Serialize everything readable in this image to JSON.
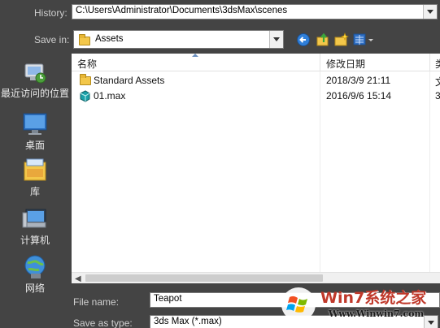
{
  "history": {
    "label": "History:",
    "value": "C:\\Users\\Administrator\\Documents\\3dsMax\\scenes"
  },
  "save_in": {
    "label": "Save in:",
    "value": "Assets"
  },
  "toolbar": {
    "back_icon": "back-arrow-icon",
    "up_icon": "up-folder-icon",
    "new_folder_icon": "new-folder-icon",
    "view_icon": "view-menu-icon"
  },
  "places": [
    {
      "label": "最近访问的位置",
      "icon": "recent-places-icon"
    },
    {
      "label": "桌面",
      "icon": "desktop-icon"
    },
    {
      "label": "库",
      "icon": "libraries-icon"
    },
    {
      "label": "计算机",
      "icon": "computer-icon"
    },
    {
      "label": "网络",
      "icon": "network-icon"
    }
  ],
  "file_list": {
    "columns": {
      "name": "名称",
      "date": "修改日期",
      "extra": "类"
    },
    "rows": [
      {
        "name": "Standard Assets",
        "date": "2018/3/9 21:11",
        "extra": "文",
        "icon": "folder-icon"
      },
      {
        "name": "01.max",
        "date": "2016/9/6 15:14",
        "extra": "3",
        "icon": "max-file-icon"
      }
    ]
  },
  "file_name": {
    "label": "File name:",
    "value": "Teapot"
  },
  "save_as_type": {
    "label": "Save as type:",
    "value": "3ds Max (*.max)"
  },
  "watermark": {
    "logo_text": "Win7系统之家",
    "url": "Www.Winwin7.com"
  }
}
